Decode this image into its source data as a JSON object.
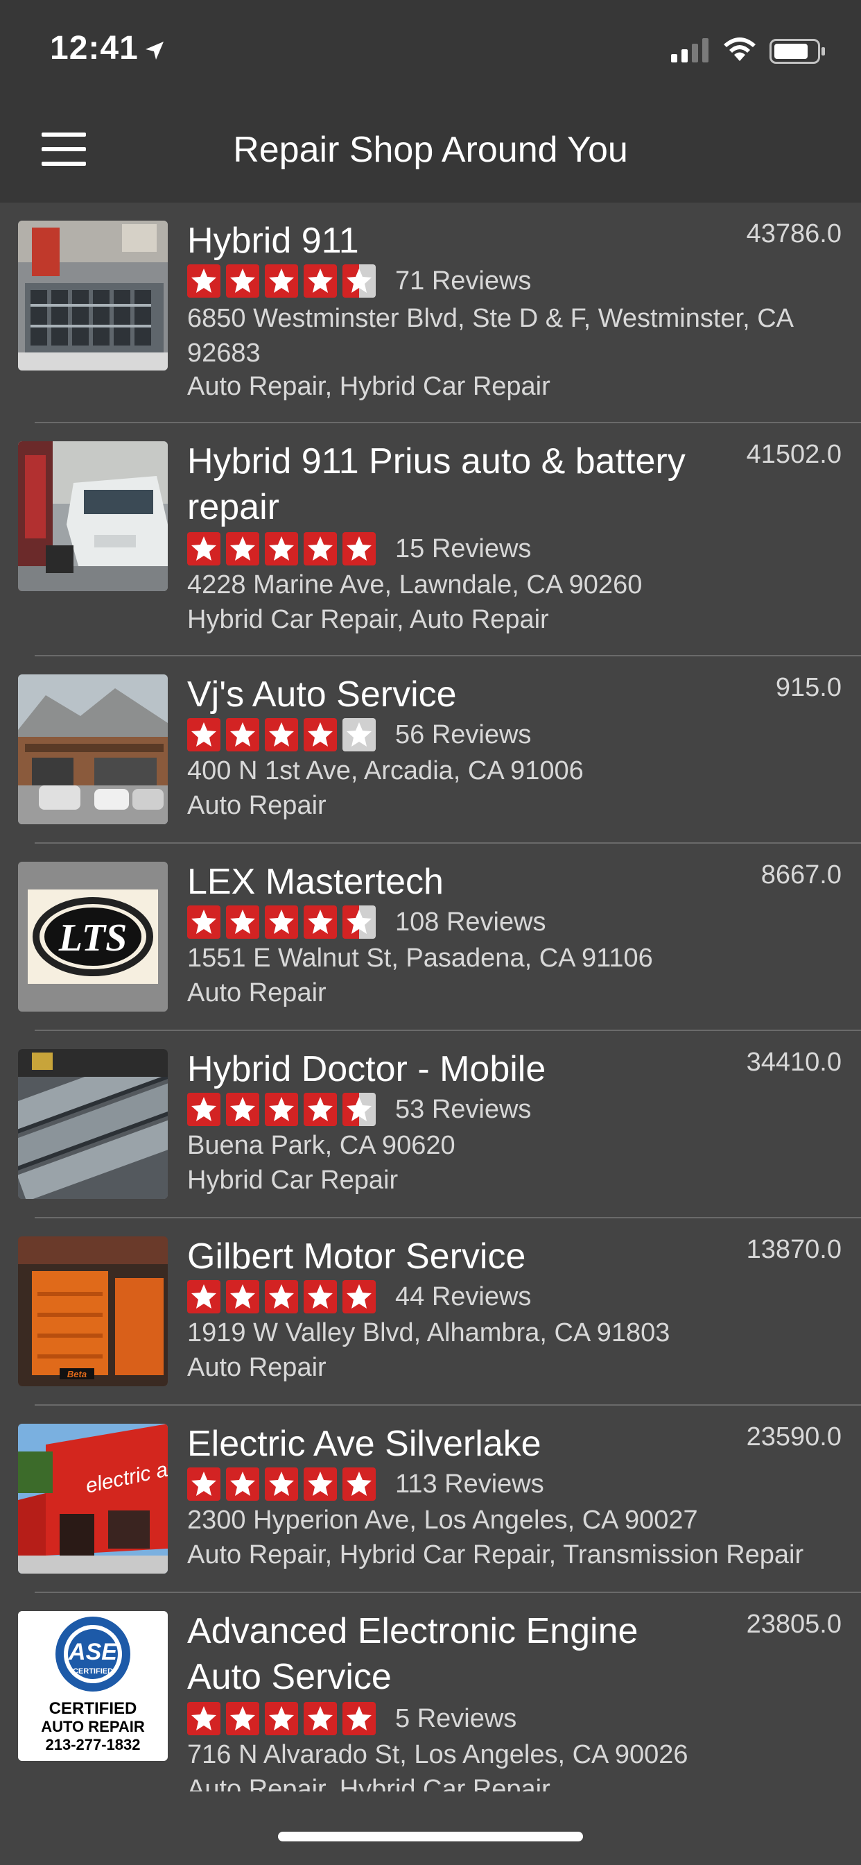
{
  "status": {
    "time": "12:41"
  },
  "nav": {
    "title": "Repair Shop Around You"
  },
  "colors": {
    "star_red": "#d32323",
    "star_gray": "#d0d0d0",
    "background": "#444444",
    "bar": "#373737"
  },
  "shops": [
    {
      "name": "Hybrid 911",
      "distance": "43786.0",
      "rating": 4.5,
      "reviews": "71 Reviews",
      "address": "6850 Westminster Blvd, Ste D & F, Westminster, CA 92683",
      "categories": "Auto Repair, Hybrid Car Repair"
    },
    {
      "name": "Hybrid 911 Prius auto & battery repair",
      "distance": "41502.0",
      "rating": 5,
      "reviews": "15 Reviews",
      "address": "4228 Marine Ave, Lawndale, CA 90260",
      "categories": "Hybrid Car Repair, Auto Repair"
    },
    {
      "name": "Vj's Auto Service",
      "distance": "915.0",
      "rating": 4,
      "reviews": "56 Reviews",
      "address": "400 N 1st Ave, Arcadia, CA 91006",
      "categories": "Auto Repair"
    },
    {
      "name": "LEX Mastertech",
      "distance": "8667.0",
      "rating": 4.5,
      "reviews": "108 Reviews",
      "address": "1551 E Walnut St, Pasadena, CA 91106",
      "categories": "Auto Repair"
    },
    {
      "name": "Hybrid Doctor - Mobile",
      "distance": "34410.0",
      "rating": 4.5,
      "reviews": "53 Reviews",
      "address": "Buena Park, CA 90620",
      "categories": "Hybrid Car Repair"
    },
    {
      "name": "Gilbert Motor Service",
      "distance": "13870.0",
      "rating": 5,
      "reviews": "44 Reviews",
      "address": "1919 W Valley Blvd, Alhambra, CA 91803",
      "categories": "Auto Repair"
    },
    {
      "name": "Electric Ave Silverlake",
      "distance": "23590.0",
      "rating": 5,
      "reviews": "113 Reviews",
      "address": "2300 Hyperion Ave, Los Angeles, CA 90027",
      "categories": "Auto Repair, Hybrid Car Repair, Transmission Repair"
    },
    {
      "name": "Advanced Electronic Engine Auto Service",
      "distance": "23805.0",
      "rating": 5,
      "reviews": "5 Reviews",
      "address": "716 N Alvarado St, Los Angeles, CA 90026",
      "categories": "Auto Repair, Hybrid Car Repair"
    }
  ],
  "thumb_text": {
    "lts": "LTS",
    "electric_sign": "electric ave.",
    "ase_top": "ASE",
    "ase_mid": "CERTIFIED",
    "ase_line1": "CERTIFIED",
    "ase_line2": "AUTO REPAIR",
    "ase_phone": "213-277-1832",
    "beta": "Beta"
  }
}
